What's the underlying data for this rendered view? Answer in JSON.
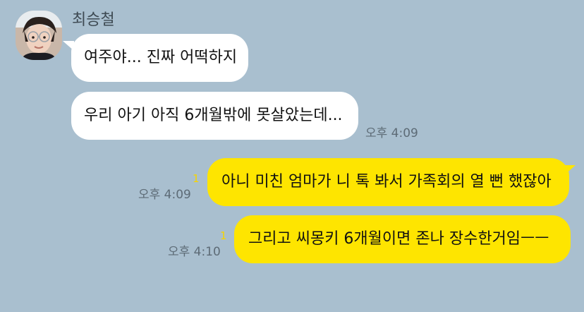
{
  "chat": {
    "sender_name": "최승철",
    "messages": [
      {
        "direction": "incoming",
        "text": "여주야... 진짜 어떡하지",
        "time": ""
      },
      {
        "direction": "incoming",
        "text": "우리 아기 아직 6개월밖에 못살았는데...",
        "time": "오후 4:09"
      },
      {
        "direction": "outgoing",
        "text": "아니 미친 엄마가 니 톡 봐서 가족회의 열 뻔 했잖아",
        "time": "오후 4:09",
        "unread": "1"
      },
      {
        "direction": "outgoing",
        "text": "그리고 씨몽키 6개월이면 존나 장수한거임ㅡㅡ",
        "time": "오후 4:10",
        "unread": "1"
      }
    ]
  },
  "colors": {
    "background": "#a9bfcf",
    "incoming_bubble": "#ffffff",
    "outgoing_bubble": "#fee500",
    "unread_count": "#f7d400",
    "timestamp": "#5d6b76"
  },
  "icons": {
    "avatar": "profile-photo"
  }
}
